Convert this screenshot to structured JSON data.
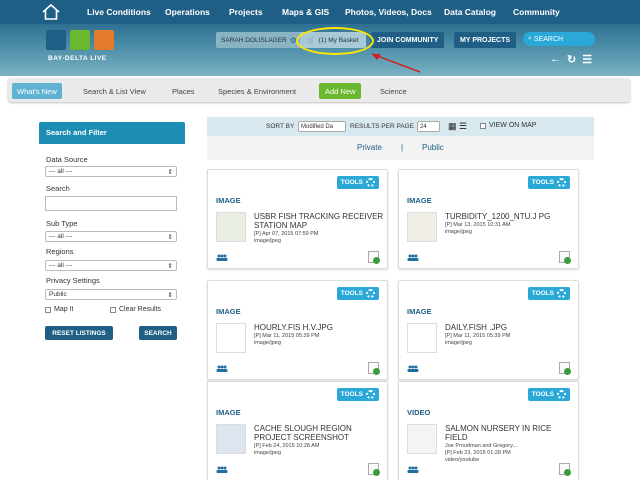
{
  "topnav": {
    "items": [
      "Live Conditions",
      "Operations",
      "Projects",
      "Maps & GIS",
      "Photos, Videos, Docs",
      "Data Catalog",
      "Community"
    ]
  },
  "header": {
    "logo_text": "BAY-DELTA LIVE",
    "user_label": "SARAH DOLISLAGER",
    "basket_label": "(1) My Basket",
    "join_label": "JOIN COMMUNITY",
    "projects_label": "MY PROJECTS",
    "search_label": "SEARCH",
    "icons": [
      "back-arrow-icon",
      "refresh-icon",
      "list-icon"
    ]
  },
  "subnav": {
    "tabs": [
      "What's New",
      "Search & List View",
      "Places",
      "Species & Environment",
      "Add New",
      "Science"
    ]
  },
  "sidebar": {
    "title": "Search and Filter",
    "data_source_label": "Data Source",
    "data_source_value": "--- all ---",
    "search_label": "Search",
    "search_value": "",
    "subtype_label": "Sub Type",
    "subtype_value": "--- all ---",
    "regions_label": "Regions",
    "regions_value": "--- all ---",
    "privacy_label": "Privacy Settings",
    "privacy_value": "Public",
    "map_it_label": "Map It",
    "clear_results_label": "Clear Results",
    "reset_label": "RESET LISTINGS",
    "search_button": "SEARCH"
  },
  "sortbar": {
    "sort_by_label": "SORT BY",
    "sort_by_value": "Modified Da",
    "per_page_label": "RESULTS PER PAGE",
    "per_page_value": "24",
    "view_on_map_label": "VIEW ON MAP",
    "private_label": "Private",
    "separator": "|",
    "public_label": "Public"
  },
  "cards": [
    {
      "tools": "TOOLS",
      "type": "IMAGE",
      "title": "USBR FISH TRACKING RECEIVER STATION MAP",
      "date": "[P] Apr 07, 2015 07:59 PM",
      "author": "",
      "format": "image/jpeg"
    },
    {
      "tools": "TOOLS",
      "type": "IMAGE",
      "title": "TURBIDITY_1200_NTU.J PG",
      "date": "[P] Mar 13, 2015 10:31 AM",
      "author": "",
      "format": "image/jpeg"
    },
    {
      "tools": "TOOLS",
      "type": "IMAGE",
      "title": "HOURLY.FIS H.V.JPG",
      "date": "[P] Mar 11, 2015 05:39 PM",
      "author": "",
      "format": "image/jpeg"
    },
    {
      "tools": "TOOLS",
      "type": "IMAGE",
      "title": "DAILY.FISH .JPG",
      "date": "[P] Mar 11, 2015 05:39 PM",
      "author": "",
      "format": "image/jpeg"
    },
    {
      "tools": "TOOLS",
      "type": "IMAGE",
      "title": "CACHE SLOUGH REGION PROJECT SCREENSHOT",
      "date": "[P] Feb 24, 2015 10:28 AM",
      "author": "",
      "format": "image/jpeg"
    },
    {
      "tools": "TOOLS",
      "type": "VIDEO",
      "title": "SALMON NURSERY IN RICE FIELD",
      "date": "[P] Feb 23, 2015 01:28 PM",
      "author": "Joe Proudman and Gregory...",
      "format": "video/youtube"
    }
  ],
  "colors": {
    "nav_dark": "#1f5f86",
    "accent_blue": "#2aa8d8",
    "add_green": "#6bb830",
    "highlight": "#ffe600"
  }
}
